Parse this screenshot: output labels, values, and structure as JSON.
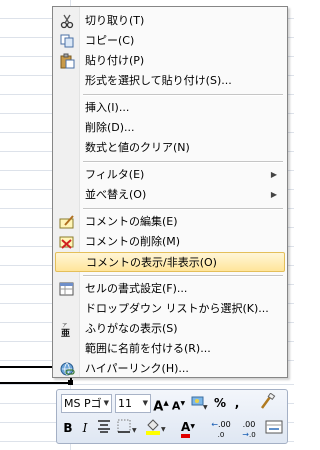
{
  "menu": {
    "items": [
      {
        "label": "切り取り(T)",
        "icon": "scissors-icon"
      },
      {
        "label": "コピー(C)",
        "icon": "copy-icon"
      },
      {
        "label": "貼り付け(P)",
        "icon": "paste-icon"
      },
      {
        "label": "形式を選択して貼り付け(S)..."
      },
      {
        "label": "挿入(I)..."
      },
      {
        "label": "削除(D)..."
      },
      {
        "label": "数式と値のクリア(N)"
      },
      {
        "label": "フィルタ(E)",
        "submenu": true
      },
      {
        "label": "並べ替え(O)",
        "submenu": true
      },
      {
        "label": "コメントの編集(E)",
        "icon": "edit-comment-icon"
      },
      {
        "label": "コメントの削除(M)",
        "icon": "delete-comment-icon"
      },
      {
        "label": "コメントの表示/非表示(O)",
        "highlighted": true
      },
      {
        "label": "セルの書式設定(F)...",
        "icon": "format-cells-icon"
      },
      {
        "label": "ドロップダウン リストから選択(K)..."
      },
      {
        "label": "ふりがなの表示(S)",
        "icon": "furigana-icon"
      },
      {
        "label": "範囲に名前を付ける(R)..."
      },
      {
        "label": "ハイパーリンク(H)...",
        "icon": "hyperlink-icon"
      }
    ]
  },
  "mini_toolbar": {
    "font_name": "MS Pゴ",
    "font_size": "11",
    "bold": "B",
    "italic": "I",
    "percent": "%",
    "comma": ",",
    "increase_decimal": ".00",
    "decrease_decimal": ".00",
    "font_color": "A"
  },
  "colors": {
    "highlight_border": "#e4bf5a",
    "highlight_fill": "#ffe59a",
    "font_color_bar": "#e00000",
    "fill_color_bar": "#ffff00"
  }
}
